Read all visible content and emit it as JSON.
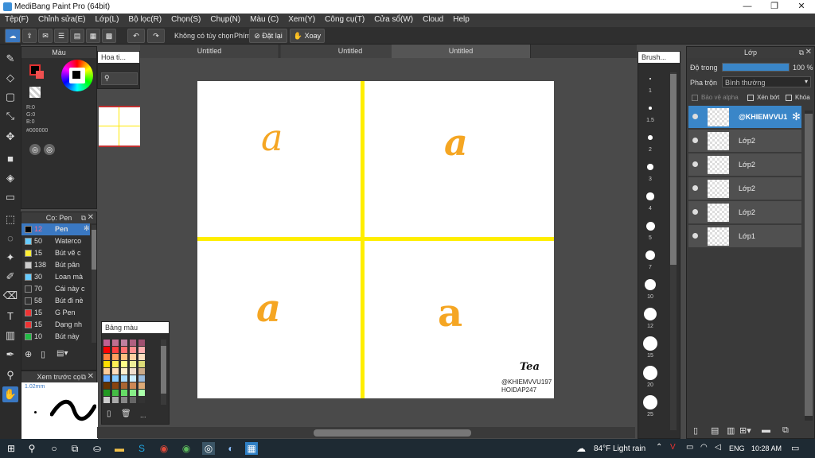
{
  "window": {
    "title": "MediBang Paint Pro (64bit)"
  },
  "menu": [
    "Tệp(F)",
    "Chỉnh sửa(E)",
    "Lớp(L)",
    "Bộ lọc(R)",
    "Chọn(S)",
    "Chụp(N)",
    "Màu (C)",
    "Xem(Y)",
    "Công cụ(T)",
    "Cửa sổ(W)",
    "Cloud",
    "Help"
  ],
  "toolbar": {
    "no_option": "Không có tùy chọn",
    "key_label": "Phím",
    "reset": "Đặt lại",
    "rotate": "Xoay"
  },
  "color_panel": {
    "title": "Màu",
    "r": "R:0",
    "g": "G:0",
    "b": "B:0",
    "hex": "#000000"
  },
  "navigator": {
    "title": "Hoa ti..."
  },
  "tabs": [
    "Untitled",
    "Untitled",
    "Untitled"
  ],
  "brush_panel": {
    "title": "Cọ: Pen",
    "items": [
      {
        "size": "12",
        "name": "Pen",
        "color": "#55aaff"
      },
      {
        "size": "50",
        "name": "Waterco",
        "color": "#66ccff"
      },
      {
        "size": "15",
        "name": "Bút vẽ c",
        "color": "#ffee33"
      },
      {
        "size": "138",
        "name": "Bút pân",
        "color": "#cccccc"
      },
      {
        "size": "30",
        "name": "Loan mà",
        "color": "#66ccff"
      },
      {
        "size": "70",
        "name": "Cái này c",
        "color": "#333333"
      },
      {
        "size": "58",
        "name": "Bút đi nè",
        "color": "#333333"
      },
      {
        "size": "15",
        "name": "G Pen",
        "color": "#ee3333"
      },
      {
        "size": "15",
        "name": "Dạng nh",
        "color": "#ee3333"
      },
      {
        "size": "10",
        "name": "Bút này",
        "color": "#22bb44"
      }
    ]
  },
  "preview_panel": {
    "title": "Xem trước cọ",
    "size": "1.02mm"
  },
  "palette_panel": {
    "title": "Bảng màu",
    "more": "..."
  },
  "brush_size_panel": {
    "title": "Brush...",
    "sizes": [
      "1",
      "1.5",
      "2",
      "3",
      "4",
      "5",
      "7",
      "10",
      "12",
      "15",
      "20",
      "25"
    ]
  },
  "canvas": {
    "letters": [
      "a",
      "a",
      "a",
      "a"
    ],
    "signature": "Tea",
    "watermark1": "@KHIEMVVU197",
    "watermark2": "HOIDAP247"
  },
  "layer_panel": {
    "title": "Lớp",
    "opacity_label": "Độ trong",
    "opacity_value": "100 %",
    "opacity_fraction": 1.0,
    "blend_label": "Pha trộn",
    "blend_value": "Bình thường",
    "protect_alpha": "Bảo vệ alpha",
    "clip": "Xén bớt",
    "lock": "Khóa",
    "layers": [
      "@KHIEMVVU1",
      "Lớp2",
      "Lớp2",
      "Lớp2",
      "Lớp2",
      "Lớp1"
    ]
  },
  "taskbar": {
    "weather": "84°F  Light rain",
    "lang": "ENG",
    "time": "10:28 AM"
  },
  "colors": {
    "accent": "#3a86c8",
    "yellow": "#ffee00",
    "orange": "#f5a623"
  }
}
